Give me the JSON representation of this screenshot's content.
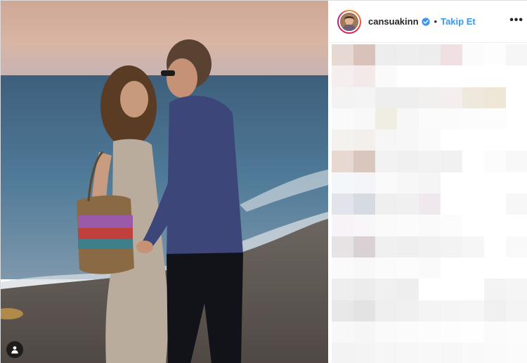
{
  "post": {
    "username": "cansuakinn",
    "separator": "•",
    "follow_label": "Takip Et",
    "more_label": "•••",
    "icons": {
      "verified": "verified-badge-icon",
      "tag": "user-tag-icon",
      "more": "more-options-icon"
    },
    "colors": {
      "follow": "#3897f0",
      "text": "#262626",
      "verified": "#3897f0"
    }
  },
  "pixel_colors": [
    [
      "#e6d9d4",
      "#d8c2b9",
      "#ededed",
      "#eeeeee",
      "#ededed",
      "#f1e0e3",
      "#fbfbfb",
      "#fdfdfd",
      "#f6f6f6"
    ],
    [
      "#f5eeee",
      "#f3e9e9",
      "#fafafa",
      "#ffffff",
      "#ffffff",
      "#ffffff",
      "#ffffff",
      "#ffffff",
      "#ffffff"
    ],
    [
      "#f3f3f3",
      "#f4f4f4",
      "#eeeeee",
      "#eeeeee",
      "#f2efef",
      "#f4eeee",
      "#efe8dc",
      "#eee7d8",
      "#ffffff"
    ],
    [
      "#fafafa",
      "#f8f8f8",
      "#f0ede3",
      "#f7f7f7",
      "#fbfbfb",
      "#fbfbfb",
      "#fcfcfc",
      "#fcfcfc",
      "#ffffff"
    ],
    [
      "#f4f2ef",
      "#f3efea",
      "#f6f6f6",
      "#f7f7f7",
      "#fafafa",
      "#ffffff",
      "#ffffff",
      "#ffffff",
      "#ffffff"
    ],
    [
      "#e7d8d2",
      "#d9c6bc",
      "#f2f2f2",
      "#f0f0f0",
      "#f2f2f2",
      "#f1f1f1",
      "#ffffff",
      "#fcfcfc",
      "#f8f8f8"
    ],
    [
      "#f4f7fa",
      "#f3f5f8",
      "#fafafa",
      "#f7f7f7",
      "#f5f5f5",
      "#ffffff",
      "#ffffff",
      "#ffffff",
      "#ffffff"
    ],
    [
      "#e1e4ea",
      "#d6dbe2",
      "#efefef",
      "#f0f0f0",
      "#efe9ed",
      "#ffffff",
      "#ffffff",
      "#ffffff",
      "#f7f7f7"
    ],
    [
      "#f7f4f7",
      "#f8f6f8",
      "#fafafa",
      "#fbfbfb",
      "#fafafa",
      "#fcfcfc",
      "#ffffff",
      "#ffffff",
      "#ffffff"
    ],
    [
      "#e6e3e5",
      "#d9d1d3",
      "#f0f0f0",
      "#efefef",
      "#f1f1f1",
      "#f3f3f3",
      "#f6f6f6",
      "#ffffff",
      "#f9f9f9"
    ],
    [
      "#fafafa",
      "#f8f8f8",
      "#fbfbfb",
      "#fcfcfc",
      "#fafafa",
      "#ffffff",
      "#ffffff",
      "#ffffff",
      "#ffffff"
    ],
    [
      "#eeeeee",
      "#ececec",
      "#f0f0f0",
      "#eeeeee",
      "#ffffff",
      "#ffffff",
      "#ffffff",
      "#f3f3f3",
      "#f5f5f5"
    ],
    [
      "#e8e8e8",
      "#e3e3e3",
      "#efefef",
      "#f0f0f0",
      "#f4f4f4",
      "#f5f5f5",
      "#f6f6f6",
      "#f0f0f0",
      "#f4f4f4"
    ],
    [
      "#f8f8f8",
      "#f6f6f6",
      "#fafafa",
      "#fbfbfb",
      "#fcfcfc",
      "#fdfdfd",
      "#fefefe",
      "#fbfbfb",
      "#fcfcfc"
    ],
    [
      "#f3f3f3",
      "#f4f4f4",
      "#f6f6f6",
      "#f7f7f7",
      "#f8f8f8",
      "#f7f7f7",
      "#f9f9f9",
      "#fafafa",
      "#fbfbfb"
    ]
  ]
}
